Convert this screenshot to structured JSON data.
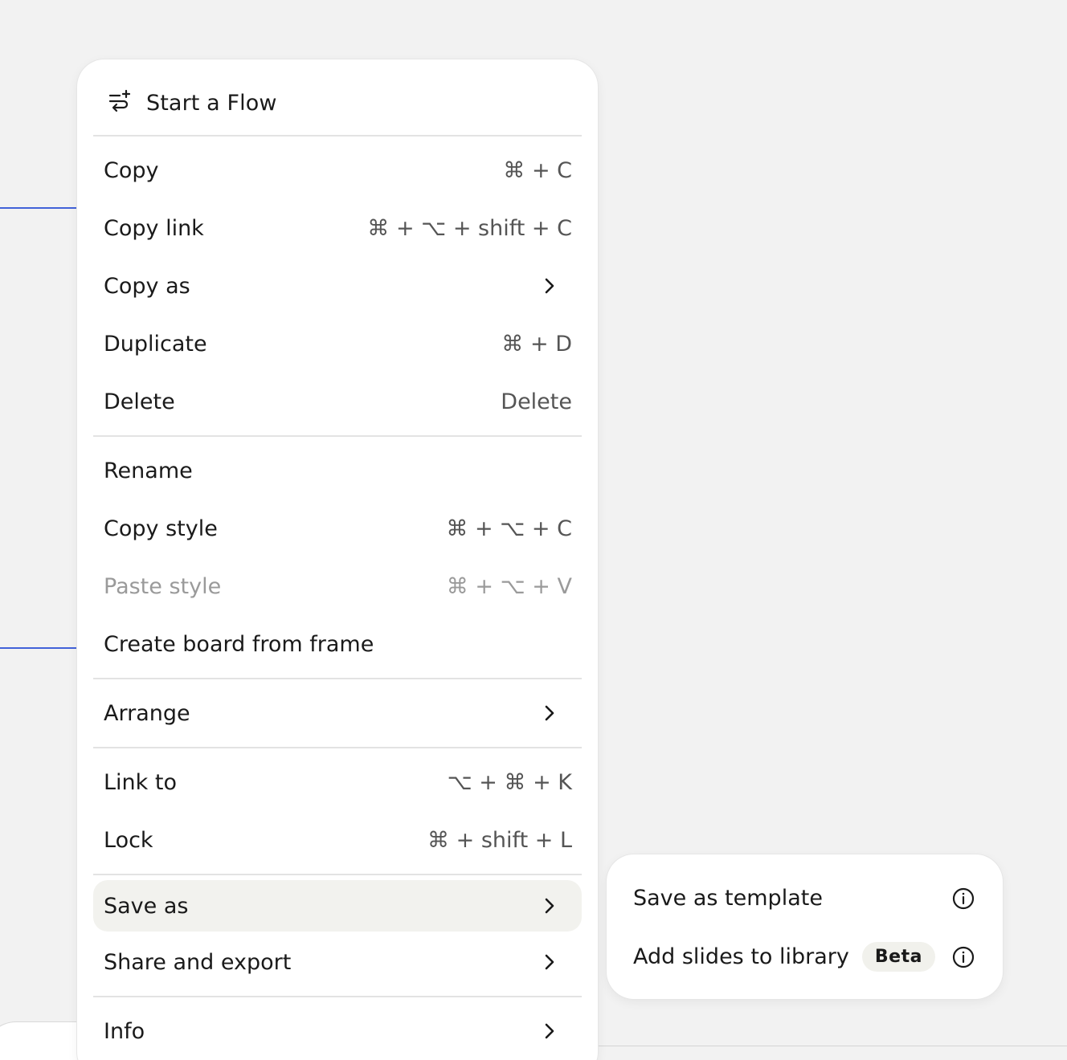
{
  "menu": {
    "flow": {
      "icon": "flow-sparkle-icon",
      "label": "Start a Flow"
    },
    "groups": [
      [
        {
          "label": "Copy",
          "shortcut": "⌘ + C"
        },
        {
          "label": "Copy link",
          "shortcut": "⌘ + ⌥ + shift + C"
        },
        {
          "label": "Copy as",
          "submenu": true
        },
        {
          "label": "Duplicate",
          "shortcut": "⌘ + D"
        },
        {
          "label": "Delete",
          "shortcut": "Delete"
        }
      ],
      [
        {
          "label": "Rename"
        },
        {
          "label": "Copy style",
          "shortcut": "⌘ + ⌥ + C"
        },
        {
          "label": "Paste style",
          "shortcut": "⌘ + ⌥ + V",
          "disabled": true
        },
        {
          "label": "Create board from frame"
        }
      ],
      [
        {
          "label": "Arrange",
          "submenu": true
        }
      ],
      [
        {
          "label": "Link to",
          "shortcut": "⌥ + ⌘ + K"
        },
        {
          "label": "Lock",
          "shortcut": "⌘ + shift + L"
        }
      ],
      [
        {
          "label": "Save as",
          "submenu": true,
          "active": true
        },
        {
          "label": "Share and export",
          "submenu": true
        }
      ],
      [
        {
          "label": "Info",
          "submenu": true
        }
      ]
    ]
  },
  "submenu": {
    "items": [
      {
        "label": "Save as template",
        "icon": "info-icon"
      },
      {
        "label": "Add slides to library",
        "badge": "Beta",
        "icon": "info-icon"
      }
    ]
  },
  "colors": {
    "canvas_bg": "#f2f2f2",
    "menu_bg": "#ffffff",
    "active_item_bg": "#f2f2ee",
    "frame_selection": "#4262d9",
    "disabled_text": "#9a9a9a"
  }
}
